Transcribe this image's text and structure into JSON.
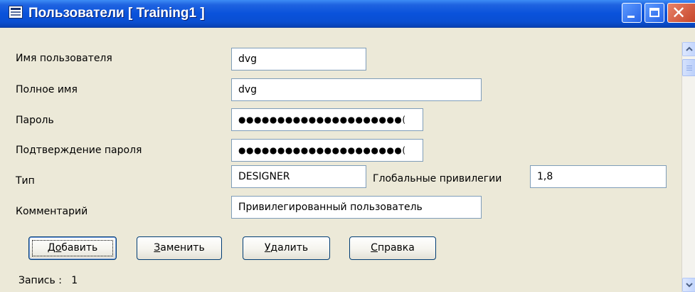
{
  "window": {
    "title": "Пользователи [ Training1 ]",
    "close_glyph": "✕"
  },
  "form": {
    "username_label": "Имя пользователя",
    "username_value": "dvg",
    "fullname_label": "Полное имя",
    "fullname_value": "dvg",
    "password_label": "Пароль",
    "password_value": "●●●●●●●●●●●●●●●●●●●●●(",
    "confirm_label": "Подтверждение пароля",
    "confirm_value": "●●●●●●●●●●●●●●●●●●●●●(",
    "type_label": "Тип",
    "type_value": "DESIGNER",
    "global_priv_label": "Глобальные привилегии",
    "global_priv_value": "1,8",
    "comment_label": "Комментарий",
    "comment_value": "Привилегированный пользователь"
  },
  "buttons": {
    "add": {
      "first": "Д",
      "accel": "о",
      "rest": "бавить"
    },
    "replace": {
      "accel": "З",
      "rest": "аменить"
    },
    "delete": {
      "accel": "У",
      "rest": "далить"
    },
    "help": {
      "accel": "С",
      "rest": "правка"
    }
  },
  "status": {
    "record_label": "Запись :",
    "record_value": "1"
  },
  "icons": {
    "app": "window-app-icon",
    "minimize": "minimize-icon",
    "maximize": "maximize-icon",
    "close": "close-icon",
    "scroll_up": "chevron-up-icon",
    "scroll_down": "chevron-down-icon"
  },
  "colors": {
    "titlebar": "#0a52db",
    "close_button": "#c6452a",
    "window_bg": "#ece9d8",
    "field_border": "#7f9db9"
  }
}
